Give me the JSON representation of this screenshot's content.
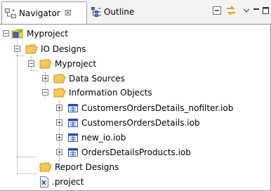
{
  "tabs": [
    {
      "label": "Navigator",
      "icon": "navigator-icon",
      "close_glyph": "☒",
      "active": true
    },
    {
      "label": "Outline",
      "icon": "outline-icon",
      "active": false
    }
  ],
  "toolbar": {
    "collapse_icon": "collapse-all-icon",
    "link_icon": "link-editor-icon",
    "menu_icon": "view-menu-icon",
    "minimize_icon": "minimize-icon",
    "maximize_icon": "maximize-icon"
  },
  "tree": {
    "root": "Myproject",
    "io_designs": "IO Designs",
    "myproject_folder": "Myproject",
    "data_sources": "Data Sources",
    "information_objects": "Information Objects",
    "iob_files": [
      "CustomersOrdersDetails_nofilter.iob",
      "CustomersOrdersDetails.iob",
      "new_io.iob",
      "OrdersDetailsProducts.iob"
    ],
    "report_designs": "Report Designs",
    "project_file": ".project"
  },
  "colors": {
    "folder": "#f5c85a",
    "folder_dark": "#c98f1c",
    "iob_blue": "#1f4fa8",
    "tab_border": "#9c9c9c"
  }
}
